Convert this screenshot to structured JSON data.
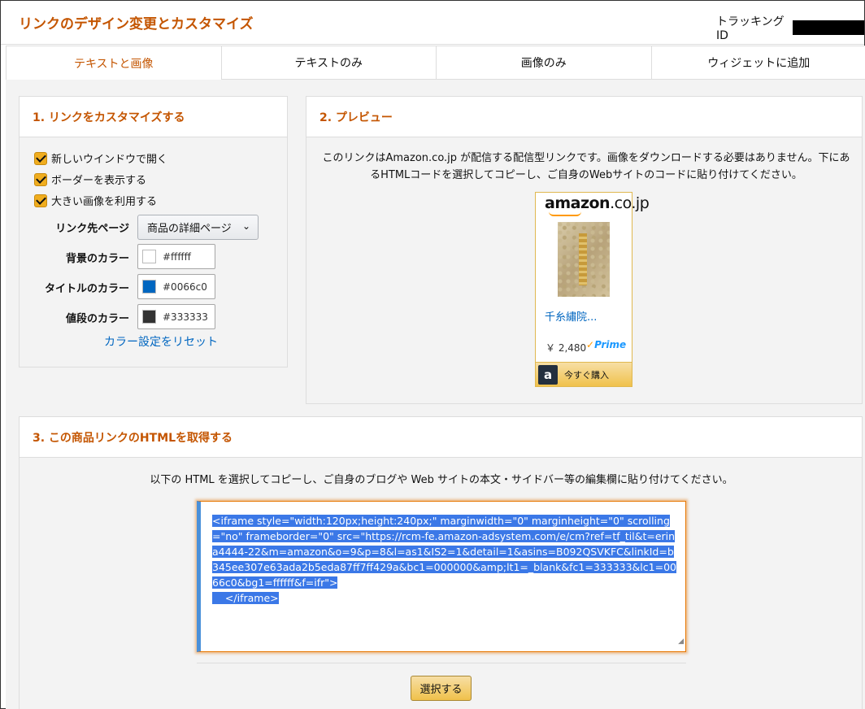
{
  "header": {
    "title": "リンクのデザイン変更とカスタマイズ",
    "tracking_label": "トラッキングID"
  },
  "tabs": [
    {
      "label": "テキストと画像",
      "active": true
    },
    {
      "label": "テキストのみ",
      "active": false
    },
    {
      "label": "画像のみ",
      "active": false
    },
    {
      "label": "ウィジェットに追加",
      "active": false
    }
  ],
  "customize": {
    "heading": "1. リンクをカスタマイズする",
    "checkboxes": [
      {
        "label": "新しいウインドウで開く",
        "checked": true
      },
      {
        "label": "ボーダーを表示する",
        "checked": true
      },
      {
        "label": "大きい画像を利用する",
        "checked": true
      }
    ],
    "link_target_label": "リンク先ページ",
    "link_target_value": "商品の詳細ページ",
    "bg_color_label": "背景のカラー",
    "bg_color_value": "#ffffff",
    "title_color_label": "タイトルのカラー",
    "title_color_value": "#0066c0",
    "price_color_label": "値段のカラー",
    "price_color_value": "#333333",
    "reset_link": "カラー設定をリセット"
  },
  "preview": {
    "heading": "2. プレビュー",
    "description": "このリンクはAmazon.co.jp が配信する配信型リンクです。画像をダウンロードする必要はありません。下にあるHTMLコードを選択してコピーし、ご自身のWebサイトのコードに貼り付けてください。",
    "ad": {
      "logo": "amazon",
      "logo_suffix": ".co.jp",
      "title": "千糸繡院...",
      "price": "￥ 2,480",
      "prime": "Prime",
      "buy_label": "今すぐ購入",
      "a_icon": "a"
    }
  },
  "get_html": {
    "heading": "3. この商品リンクのHTMLを取得する",
    "description": "以下の HTML を選択してコピーし、ご自身のブログや Web サイトの本文・サイドバー等の編集欄に貼り付けてください。",
    "code": "<iframe style=\"width:120px;height:240px;\" marginwidth=\"0\" marginheight=\"0\" scrolling=\"no\" frameborder=\"0\" src=\"https://rcm-fe.amazon-adsystem.com/e/cm?ref=tf_til&t=erina4444-22&m=amazon&o=9&p=8&l=as1&IS2=1&detail=1&asins=B092QSVKFC&linkId=b345ee307e63ada2b5eda87ff7ff429a&bc1=000000&amp;lt1=_blank&fc1=333333&lc1=0066c0&bg1=ffffff&f=ifr\">\n    </iframe>",
    "select_button": "選択する"
  }
}
